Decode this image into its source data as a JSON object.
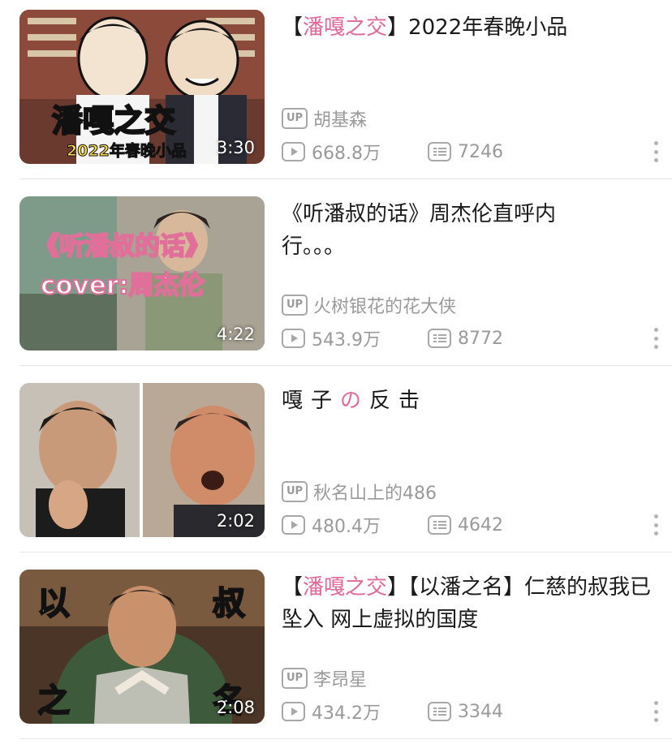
{
  "videos": [
    {
      "title_prefix": "【",
      "title_highlight": "潘嘎之交",
      "title_suffix": "】2022年春晚小品",
      "uploader": "胡基森",
      "plays": "668.8万",
      "danmaku": "7246",
      "duration": "3:30",
      "thumb_text_1": "潘嘎之交",
      "thumb_text_2": "2022年春晚小品"
    },
    {
      "title": "《听潘叔的话》周杰伦直呼内行。。。",
      "uploader": "火树银花的花大侠",
      "plays": "543.9万",
      "danmaku": "8772",
      "duration": "4:22",
      "thumb_text_1": "《听潘叔的话》",
      "thumb_text_2": "cover:周杰伦"
    },
    {
      "title_a": "嘎子",
      "title_highlight": "の",
      "title_b": "反击",
      "uploader": "秋名山上的486",
      "plays": "480.4万",
      "danmaku": "4642",
      "duration": "2:02"
    },
    {
      "title_prefix": "【",
      "title_highlight": "潘嘎之交",
      "title_suffix": "】【以潘之名】仁慈的叔我已坠入 网上虚拟的国度",
      "uploader": "李昂星",
      "plays": "434.2万",
      "danmaku": "3344",
      "duration": "2:08",
      "thumb_chars": [
        "以",
        "叔",
        "之",
        "名"
      ]
    }
  ],
  "labels": {
    "up_badge": "UP"
  },
  "colors": {
    "highlight": "#e06a97",
    "meta_gray": "#9a9a9a",
    "title_text": "#1a1a1a"
  },
  "icons": [
    "up-icon",
    "play-icon",
    "danmaku-icon",
    "more-icon"
  ]
}
